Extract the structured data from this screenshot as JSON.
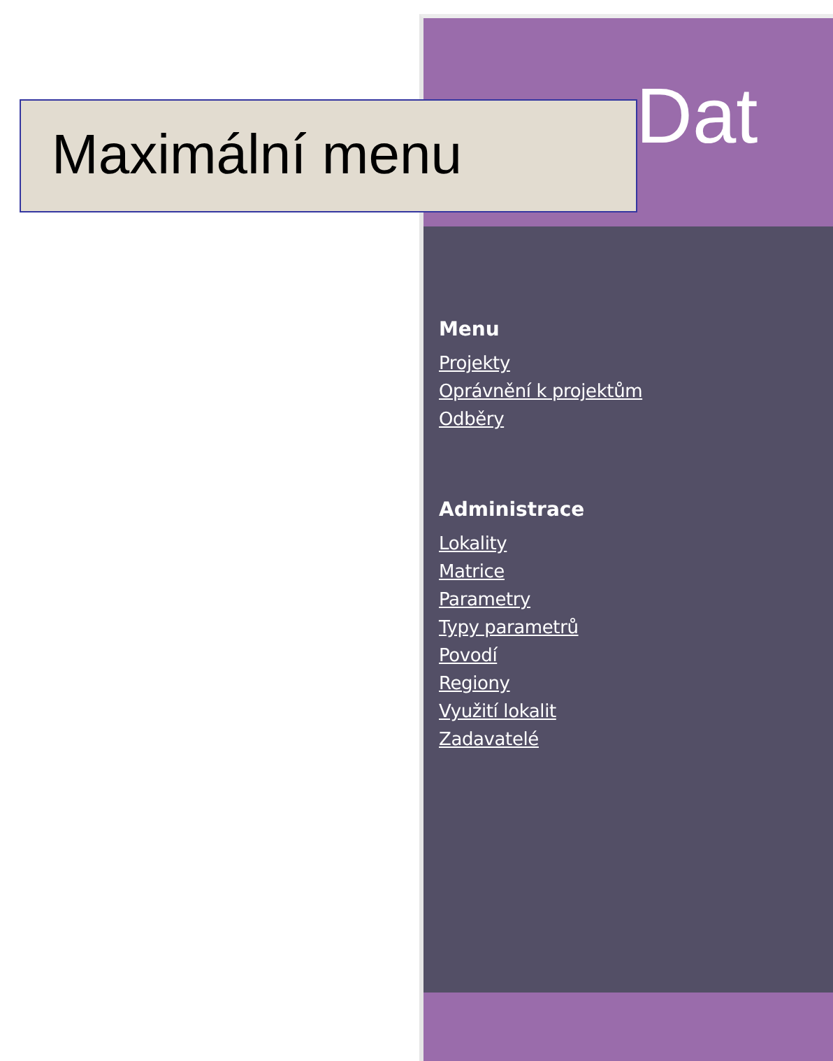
{
  "callout": {
    "label": "Maximální menu"
  },
  "header": {
    "title": "Dat"
  },
  "sections": [
    {
      "heading": "Menu",
      "links": [
        "Projekty",
        "Oprávnění k projektům",
        "Odběry"
      ]
    },
    {
      "heading": "Administrace",
      "links": [
        "Lokality",
        "Matrice",
        "Parametry",
        "Typy parametrů",
        "Povodí",
        "Regiony",
        "Využití lokalit",
        "Zadavatelé"
      ]
    }
  ]
}
